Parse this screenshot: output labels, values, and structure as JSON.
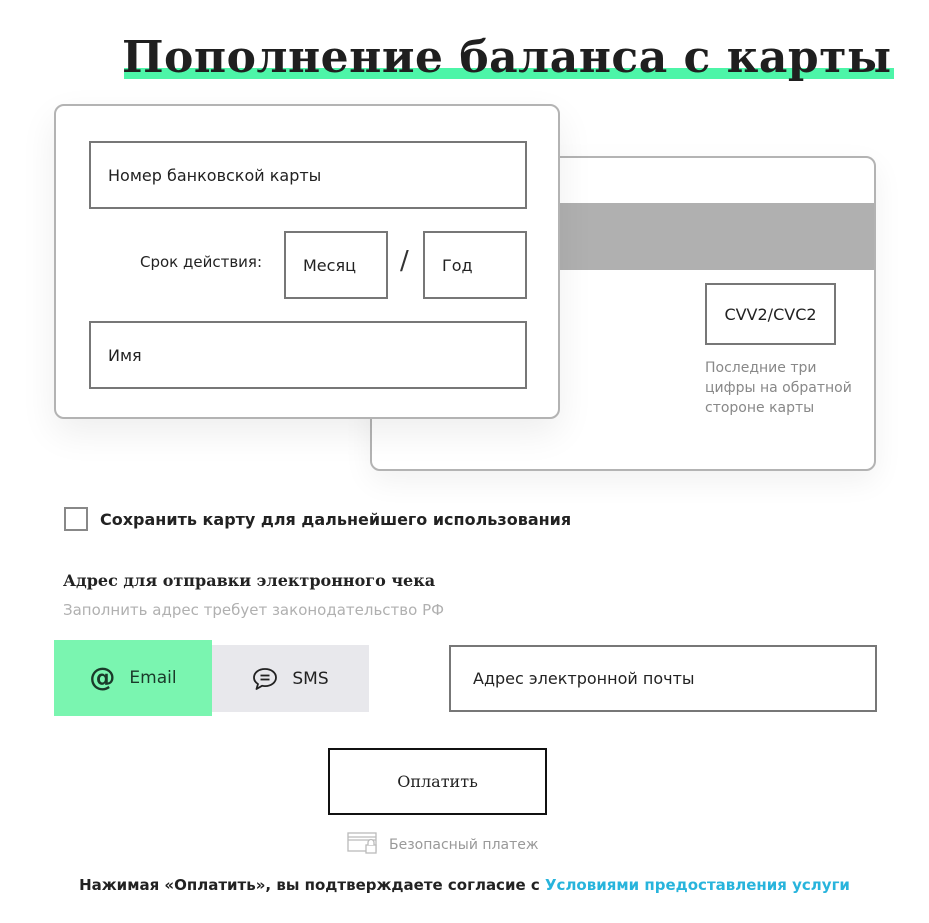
{
  "page": {
    "title": "Пополнение баланса с карты"
  },
  "colors": {
    "accent_green": "#4df5a8",
    "email_tab_bg": "#7af5b0",
    "sms_tab_bg": "#e8e8ec",
    "link": "#28b4dc",
    "magnetic_stripe": "#b0b0b0"
  },
  "card_front": {
    "card_number_placeholder": "Номер банковской карты",
    "expiry_label": "Срок действия:",
    "month_placeholder": "Месяц",
    "separator": "/",
    "year_placeholder": "Год",
    "name_placeholder": "Имя"
  },
  "card_back": {
    "cvv_placeholder": "CVV2/CVC2",
    "cvv_hint": "Последние три цифры на обратной стороне карты"
  },
  "save_card": {
    "checked": false,
    "label": "Сохранить карту для дальнейшего использования"
  },
  "receipt": {
    "title": "Адрес для отправки электронного чека",
    "subtitle": "Заполнить адрес требует законодательство РФ",
    "tabs": [
      {
        "label": "Email",
        "icon": "at-icon",
        "active": true
      },
      {
        "label": "SMS",
        "icon": "chat-bubble-icon",
        "active": false
      }
    ],
    "email_placeholder": "Адрес электронной почты"
  },
  "payment": {
    "pay_button_label": "Оплатить",
    "secure_label": "Безопасный платеж",
    "secure_icon": "card-lock-icon"
  },
  "terms": {
    "text": "Нажимая «Оплатить», вы подтверждаете согласие с ",
    "link_text": "Условиями предоставления услуги"
  }
}
